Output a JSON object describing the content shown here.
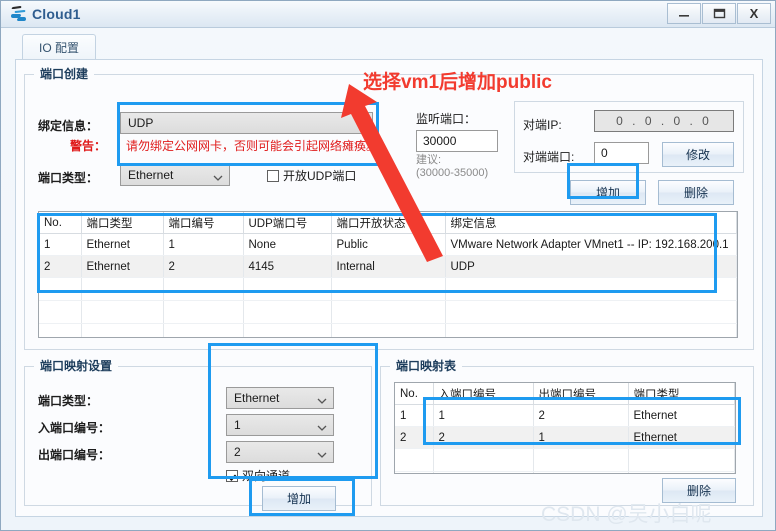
{
  "window": {
    "title": "Cloud1",
    "icon": "cloud-icon",
    "buttons": {
      "minimize": "–",
      "maximize": "❐",
      "close": "X"
    }
  },
  "tabs": [
    {
      "label": "IO 配置"
    }
  ],
  "port_create": {
    "group_title": "端口创建",
    "binding_label": "绑定信息：",
    "binding_value": "UDP",
    "warning_label": "警告：",
    "warning_text": "请勿绑定公网网卡，否则可能会引起网络瘫痪。",
    "port_type_label": "端口类型：",
    "port_type_value": "Ethernet",
    "open_udp_label": "开放UDP端口",
    "open_udp_checked": false,
    "listen_port_label": "监听端口：",
    "listen_port_value": "30000",
    "listen_hint_line1": "建议:",
    "listen_hint_line2": "(30000-35000)",
    "peer_ip_label": "对端IP:",
    "peer_ip_value": "0 . 0 . 0 . 0",
    "peer_port_label": "对端端口:",
    "peer_port_value": "0",
    "modify_button": "修改",
    "add_button": "增加",
    "delete_button": "删除"
  },
  "port_table": {
    "headers": [
      "No.",
      "端口类型",
      "端口编号",
      "UDP端口号",
      "端口开放状态",
      "绑定信息"
    ],
    "rows": [
      [
        "1",
        "Ethernet",
        "1",
        "None",
        "Public",
        "VMware Network Adapter VMnet1 -- IP: 192.168.200.1"
      ],
      [
        "2",
        "Ethernet",
        "2",
        "4145",
        "Internal",
        "UDP"
      ]
    ],
    "empty_rows": 3
  },
  "mapping_settings": {
    "group_title": "端口映射设置",
    "port_type_label": "端口类型：",
    "port_type_value": "Ethernet",
    "in_port_label": "入端口编号：",
    "in_port_value": "1",
    "out_port_label": "出端口编号：",
    "out_port_value": "2",
    "bidirectional_label": "双向通道",
    "bidirectional_checked": true,
    "add_button": "增加"
  },
  "mapping_table": {
    "group_title": "端口映射表",
    "headers": [
      "No.",
      "入端口编号",
      "出端口编号",
      "端口类型"
    ],
    "rows": [
      [
        "1",
        "1",
        "2",
        "Ethernet"
      ],
      [
        "2",
        "2",
        "1",
        "Ethernet"
      ]
    ],
    "empty_rows": 3,
    "delete_button": "删除"
  },
  "annotations": {
    "red_note": "选择vm1后增加public",
    "highlight_color": "#1e9bf0",
    "arrow_color": "#f23b2f"
  },
  "watermark": {
    "text": "CSDN @吴小白呢"
  }
}
